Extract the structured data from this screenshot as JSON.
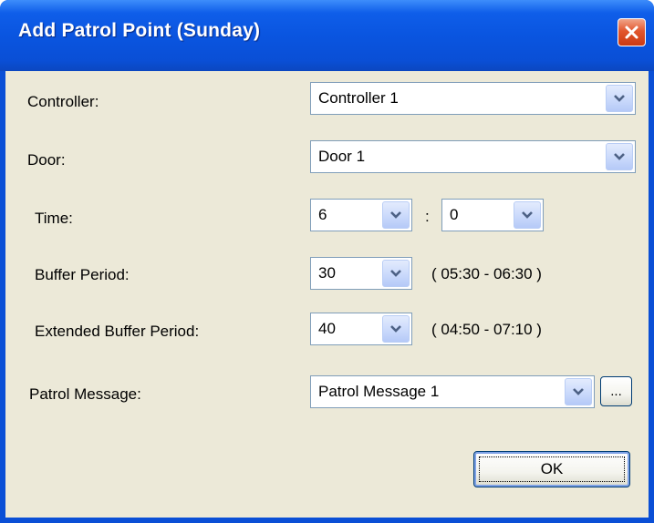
{
  "window": {
    "title": "Add Patrol Point (Sunday)",
    "close_icon": "close-icon",
    "titlebar_color": "#0a4fd6",
    "close_color": "#e2572e"
  },
  "form": {
    "controller": {
      "label": "Controller:",
      "value": "Controller 1"
    },
    "door": {
      "label": "Door:",
      "value": "Door 1"
    },
    "time": {
      "label": "Time:",
      "hour": "6",
      "separator": ":",
      "minute": "0"
    },
    "buffer": {
      "label": "Buffer Period:",
      "value": "30",
      "range": "( 05:30 - 06:30 )"
    },
    "extended_buffer": {
      "label": "Extended Buffer Period:",
      "value": "40",
      "range": "( 04:50 - 07:10 )"
    },
    "patrol_message": {
      "label": "Patrol Message:",
      "value": "Patrol Message 1",
      "browse_label": "..."
    }
  },
  "buttons": {
    "ok_label": "OK"
  },
  "icons": {
    "dropdown": "chevron-down-icon"
  },
  "colors": {
    "dialog_bg": "#ece9d8",
    "field_border": "#7f9db9"
  }
}
